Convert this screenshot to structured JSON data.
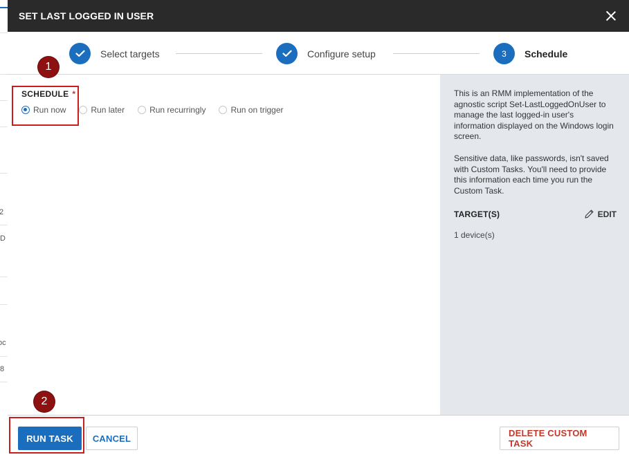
{
  "background": {
    "fragments": [
      "2",
      "D",
      "oc",
      "f8"
    ]
  },
  "dialog": {
    "title": "SET LAST LOGGED IN USER"
  },
  "stepper": {
    "steps": [
      {
        "label": "Select targets",
        "state": "done"
      },
      {
        "label": "Configure setup",
        "state": "done"
      },
      {
        "label": "Schedule",
        "number": "3",
        "state": "active"
      }
    ]
  },
  "schedule": {
    "label": "SCHEDULE",
    "required_mark": "*",
    "options": [
      {
        "label": "Run now",
        "checked": true
      },
      {
        "label": "Run later",
        "checked": false
      },
      {
        "label": "Run recurringly",
        "checked": false
      },
      {
        "label": "Run on trigger",
        "checked": false
      }
    ]
  },
  "sidebar": {
    "description": "This is an RMM implementation of the agnostic script Set-LastLoggedOnUser to manage the last logged-in user's information displayed on the Windows login screen.",
    "note": "Sensitive data, like passwords, isn't saved with Custom Tasks. You'll need to provide this information each time you run the Custom Task.",
    "targets_title": "TARGET(S)",
    "edit_label": "EDIT",
    "targets_value": "1 device(s)"
  },
  "footer": {
    "run_label": "RUN TASK",
    "cancel_label": "CANCEL",
    "delete_label": "DELETE CUSTOM TASK"
  },
  "annotations": {
    "badge_1": "1",
    "badge_2": "2"
  },
  "colors": {
    "accent": "#1a6ebd",
    "header_bg": "#2a2a2a",
    "danger": "#c0392b",
    "annotation": "#8e1111"
  }
}
